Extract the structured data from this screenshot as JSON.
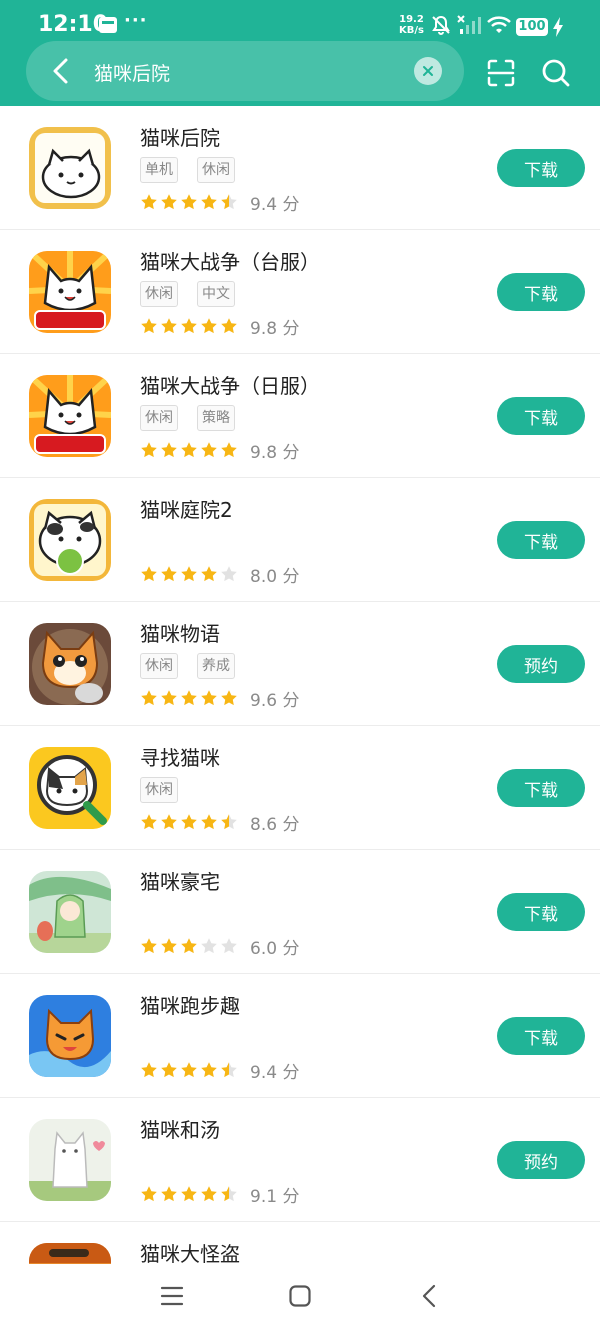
{
  "status_bar": {
    "time": "12:10",
    "dots": "···",
    "speed_value": "19.2",
    "speed_unit": "KB/s",
    "battery": "100"
  },
  "search": {
    "value": "猫咪后院",
    "placeholder": "猫咪后院"
  },
  "colors": {
    "brand": "#20b497",
    "star_filled": "#f7b614",
    "star_empty": "#e2e2e2"
  },
  "apps": [
    {
      "name": "猫咪后院",
      "tags": [
        "单机",
        "休闲"
      ],
      "stars": 4.5,
      "score": "9.4 分",
      "action": "下载"
    },
    {
      "name": "猫咪大战争（台服）",
      "tags": [
        "休闲",
        "中文"
      ],
      "stars": 5,
      "score": "9.8 分",
      "action": "下载",
      "badge": "9週年"
    },
    {
      "name": "猫咪大战争（日服）",
      "tags": [
        "休闲",
        "策略"
      ],
      "stars": 5,
      "score": "9.8 分",
      "action": "下载",
      "badge": "11周年"
    },
    {
      "name": "猫咪庭院2",
      "tags": [],
      "stars": 4,
      "score": "8.0 分",
      "action": "下载"
    },
    {
      "name": "猫咪物语",
      "tags": [
        "休闲",
        "养成"
      ],
      "stars": 5,
      "score": "9.6 分",
      "action": "预约"
    },
    {
      "name": "寻找猫咪",
      "tags": [
        "休闲"
      ],
      "stars": 4.5,
      "score": "8.6 分",
      "action": "下载"
    },
    {
      "name": "猫咪豪宅",
      "tags": [],
      "stars": 3,
      "score": "6.0 分",
      "action": "下载"
    },
    {
      "name": "猫咪跑步趣",
      "tags": [],
      "stars": 4.5,
      "score": "9.4 分",
      "action": "下载"
    },
    {
      "name": "猫咪和汤",
      "tags": [],
      "stars": 4.5,
      "score": "9.1 分",
      "action": "预约"
    },
    {
      "name": "猫咪大怪盗",
      "tags": [],
      "stars": 0,
      "score": "",
      "action": ""
    }
  ],
  "icons": {
    "back": "chevron-left-icon",
    "clear": "close-icon",
    "scan": "scan-icon",
    "search": "search-icon",
    "nav_menu": "menu-icon",
    "nav_home": "home-icon",
    "nav_back": "back-icon"
  }
}
